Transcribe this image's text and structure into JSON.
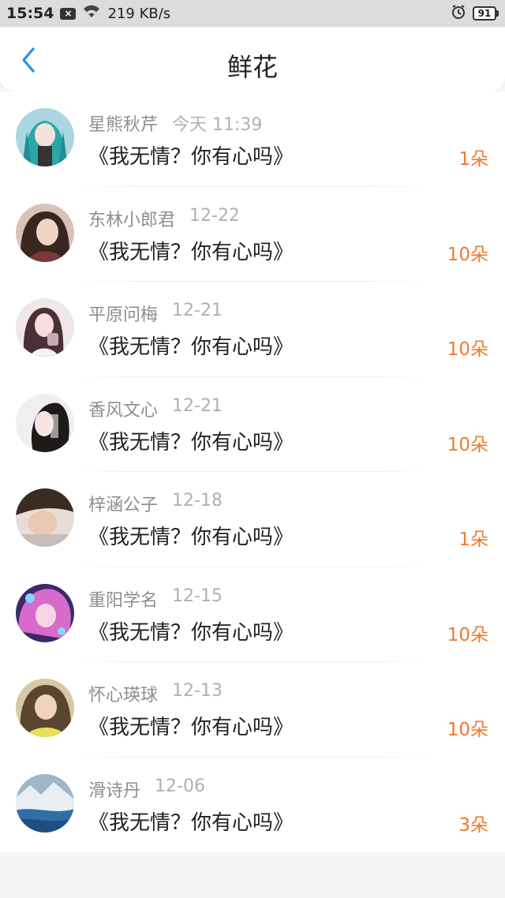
{
  "status_bar": {
    "time": "15:54",
    "notif_icon_glyph": "×",
    "net_speed": "219 KB/s",
    "battery_level": "91"
  },
  "header": {
    "title": "鲜花",
    "back_icon": "chevron-left-icon",
    "accent_color": "#2a8ee0"
  },
  "items": [
    {
      "name": "星熊秋芹",
      "date": "今天 11:39",
      "title": "《我无情？你有心吗》",
      "count": "1朵"
    },
    {
      "name": "东林小郎君",
      "date": "12-22",
      "title": "《我无情？你有心吗》",
      "count": "10朵"
    },
    {
      "name": "平原问梅",
      "date": "12-21",
      "title": "《我无情？你有心吗》",
      "count": "10朵"
    },
    {
      "name": "香风文心",
      "date": "12-21",
      "title": "《我无情？你有心吗》",
      "count": "10朵"
    },
    {
      "name": "梓涵公子",
      "date": "12-18",
      "title": "《我无情？你有心吗》",
      "count": "1朵"
    },
    {
      "name": "重阳学名",
      "date": "12-15",
      "title": "《我无情？你有心吗》",
      "count": "10朵"
    },
    {
      "name": "怀心瑛球",
      "date": "12-13",
      "title": "《我无情？你有心吗》",
      "count": "10朵"
    },
    {
      "name": "滑诗丹",
      "date": "12-06",
      "title": "《我无情？你有心吗》",
      "count": "3朵"
    }
  ],
  "colors": {
    "count_orange": "#f07a2c",
    "back_blue": "#2a8ee0"
  }
}
